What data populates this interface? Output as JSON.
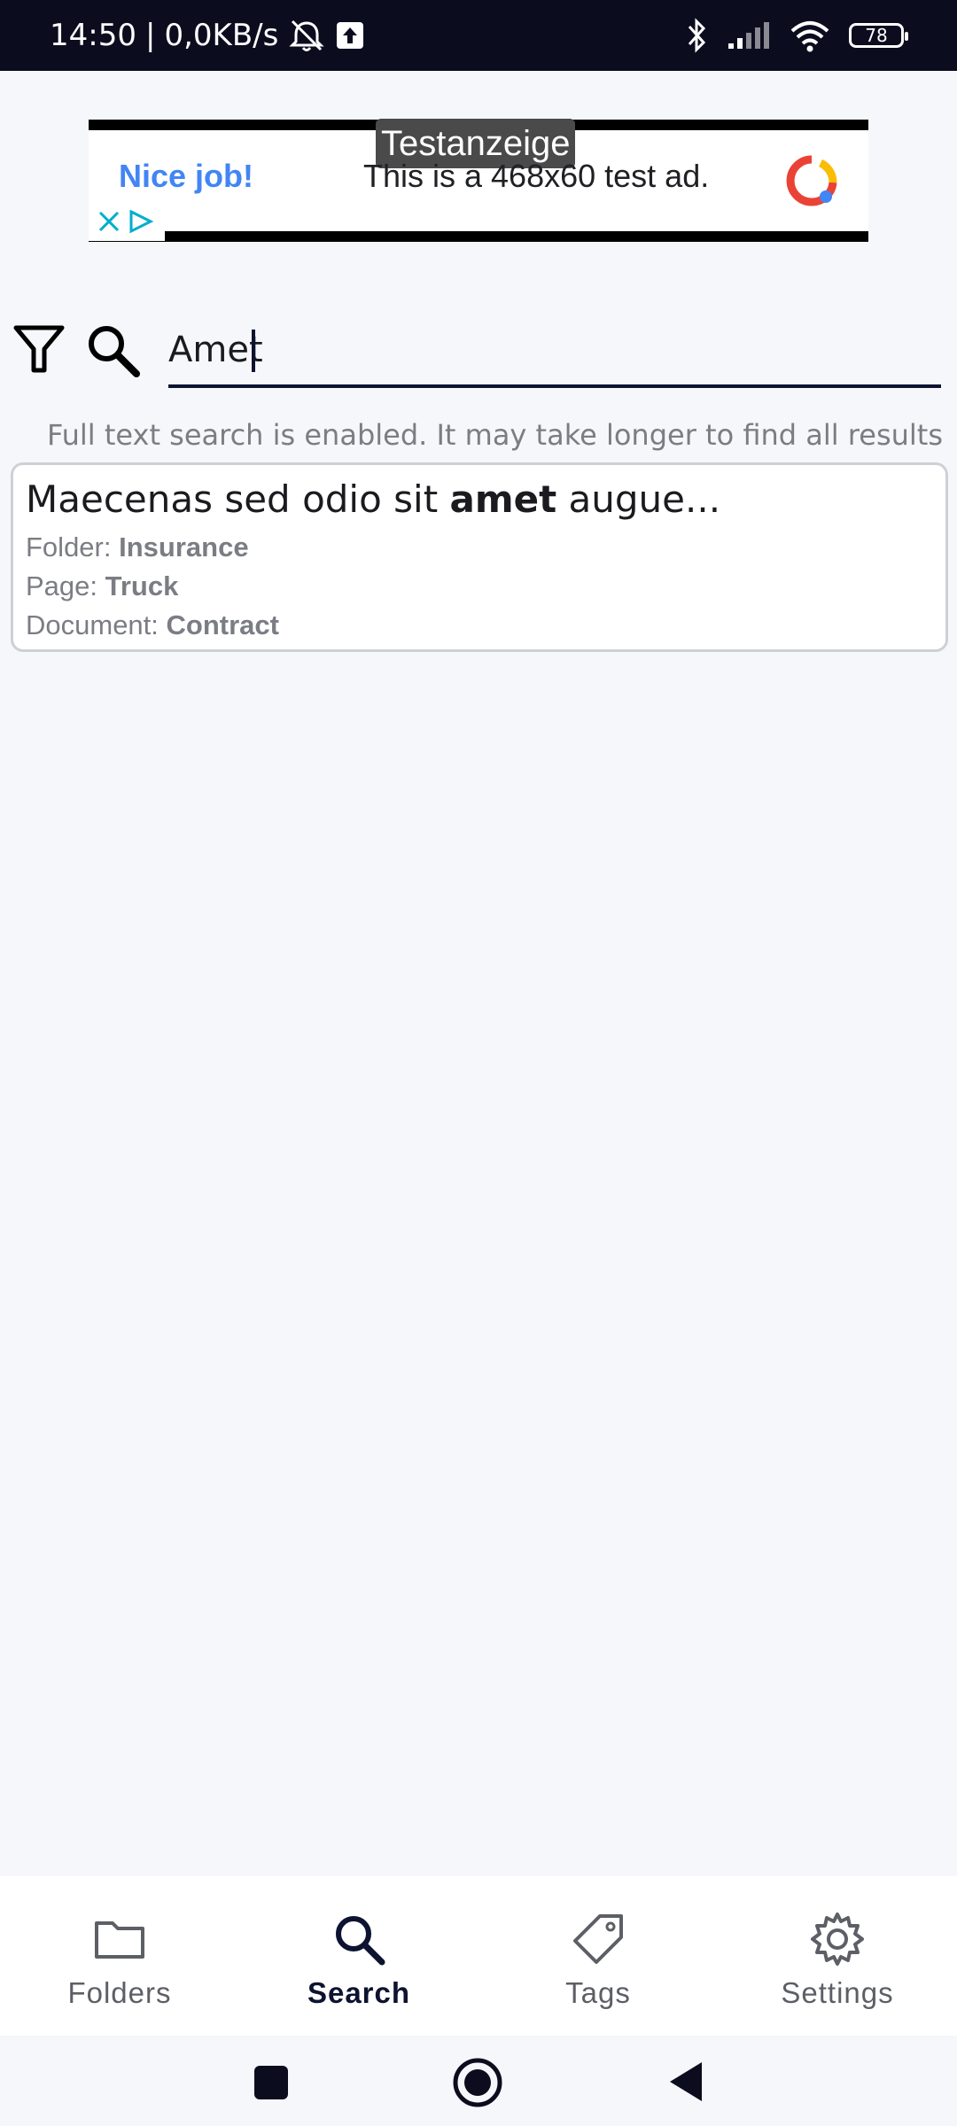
{
  "status_bar": {
    "time": "14:50",
    "separator": "|",
    "net_speed": "0,0KB/s",
    "battery": "78"
  },
  "ad": {
    "badge": "Testanzeige",
    "headline": "Nice job!",
    "text": "This is a 468x60 test ad."
  },
  "search": {
    "value": "Amet"
  },
  "hint": "Full text search is enabled. It may take longer to find all results",
  "result": {
    "snippet_prefix": "Maecenas sed odio sit ",
    "snippet_match": "amet",
    "snippet_suffix": " augue...",
    "folder_label": "Folder:",
    "folder_value": "Insurance",
    "page_label": "Page:",
    "page_value": "Truck",
    "document_label": "Document:",
    "document_value": "Contract"
  },
  "nav": {
    "items": [
      {
        "label": "Folders",
        "icon": "folder-icon",
        "active": false
      },
      {
        "label": "Search",
        "icon": "search-icon",
        "active": true
      },
      {
        "label": "Tags",
        "icon": "tag-icon",
        "active": false
      },
      {
        "label": "Settings",
        "icon": "gear-icon",
        "active": false
      }
    ]
  },
  "colors": {
    "status_bar": "#0b0d1f",
    "accent": "#0d1330",
    "background": "#f6f7fb",
    "ad_blue": "#4285f4"
  }
}
